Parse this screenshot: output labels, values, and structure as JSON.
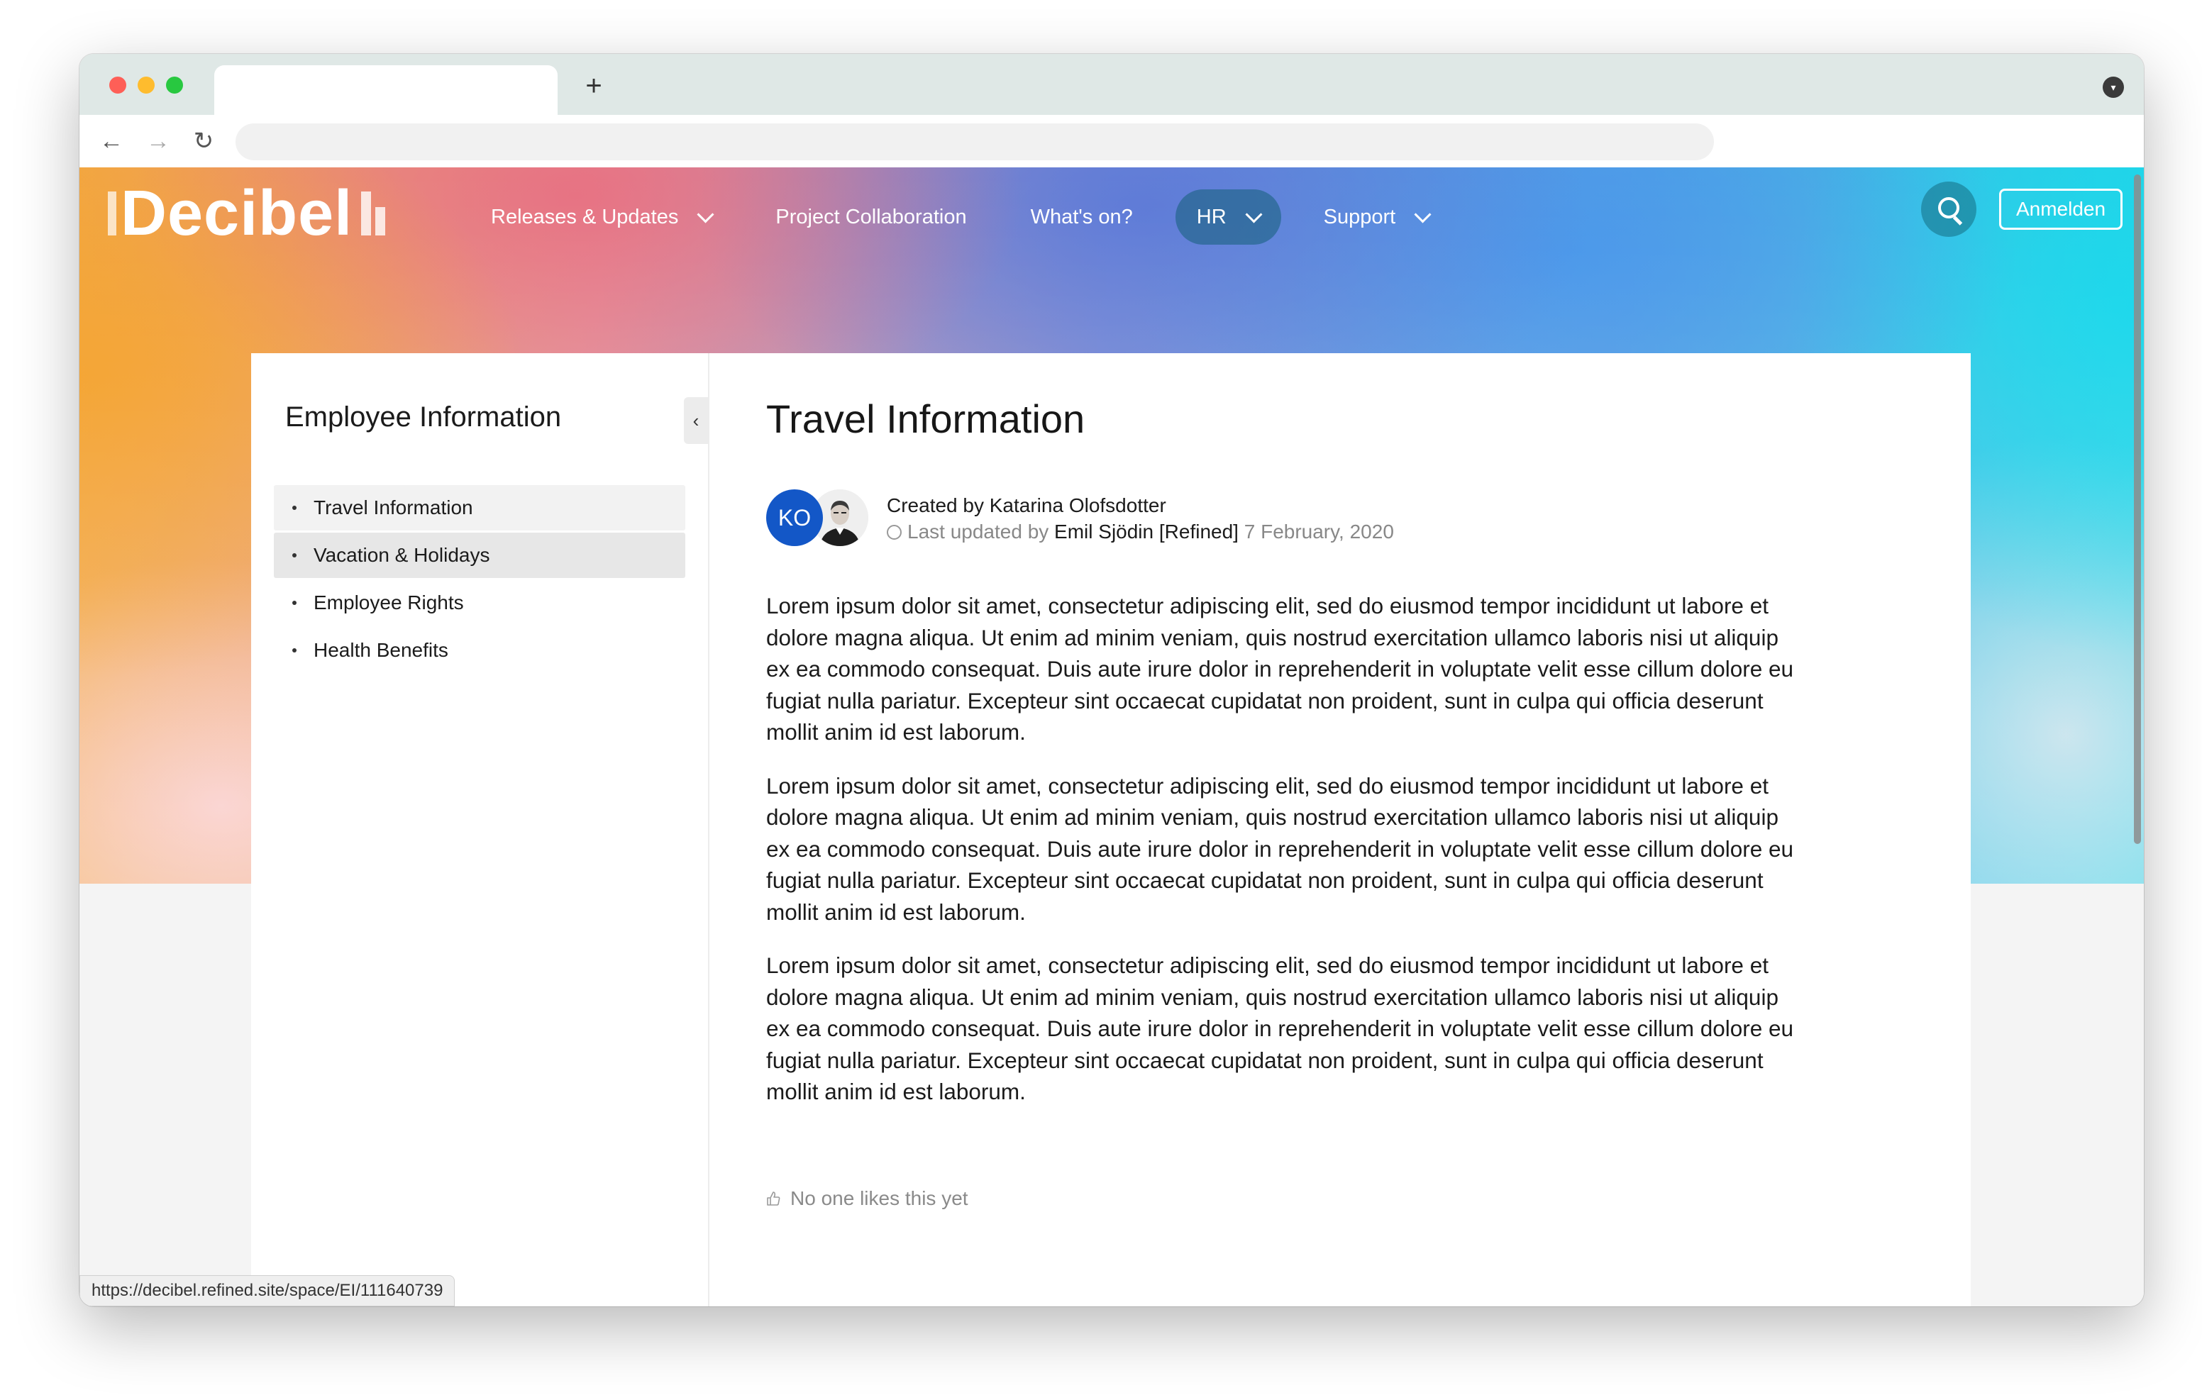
{
  "browser": {
    "new_tab_label": "+",
    "tab_menu_icon": "chevron-down-icon"
  },
  "site": {
    "logo_text": "Decibel",
    "nav": [
      {
        "label": "Releases & Updates",
        "has_dropdown": true
      },
      {
        "label": "Project Collaboration",
        "has_dropdown": false
      },
      {
        "label": "What's on?",
        "has_dropdown": false
      },
      {
        "label": "HR",
        "has_dropdown": true,
        "active": true
      },
      {
        "label": "Support",
        "has_dropdown": true
      }
    ],
    "login_label": "Anmelden"
  },
  "sidebar": {
    "title": "Employee Information",
    "collapse_icon": "‹",
    "items": [
      {
        "label": "Travel Information",
        "state": "current"
      },
      {
        "label": "Vacation & Holidays",
        "state": "hover"
      },
      {
        "label": "Employee Rights",
        "state": ""
      },
      {
        "label": "Health Benefits",
        "state": ""
      }
    ]
  },
  "page": {
    "title": "Travel Information",
    "avatar_initials": "KO",
    "created_prefix": "Created by ",
    "created_by": "Katarina Olofsdotter",
    "updated_prefix": "Last updated by ",
    "updated_by": "Emil Sjödin [Refined]",
    "updated_date": "7 February, 2020",
    "paragraphs": [
      "Lorem ipsum dolor sit amet, consectetur adipiscing elit, sed do eiusmod tempor incididunt ut labore et dolore magna aliqua. Ut enim ad minim veniam, quis nostrud exercitation ullamco laboris nisi ut aliquip ex ea commodo consequat. Duis aute irure dolor in reprehenderit in voluptate velit esse cillum dolore eu fugiat nulla pariatur. Excepteur sint occaecat cupidatat non proident, sunt in culpa qui officia deserunt mollit anim id est laborum.",
      "Lorem ipsum dolor sit amet, consectetur adipiscing elit, sed do eiusmod tempor incididunt ut labore et dolore magna aliqua. Ut enim ad minim veniam, quis nostrud exercitation ullamco laboris nisi ut aliquip ex ea commodo consequat. Duis aute irure dolor in reprehenderit in voluptate velit esse cillum dolore eu fugiat nulla pariatur. Excepteur sint occaecat cupidatat non proident, sunt in culpa qui officia deserunt mollit anim id est laborum.",
      "Lorem ipsum dolor sit amet, consectetur adipiscing elit, sed do eiusmod tempor incididunt ut labore et dolore magna aliqua. Ut enim ad minim veniam, quis nostrud exercitation ullamco laboris nisi ut aliquip ex ea commodo consequat. Duis aute irure dolor in reprehenderit in voluptate velit esse cillum dolore eu fugiat nulla pariatur. Excepteur sint occaecat cupidatat non proident, sunt in culpa qui officia deserunt mollit anim id est laborum."
    ],
    "likes_text": "No one likes this yet"
  },
  "status_bar": {
    "url": "https://decibel.refined.site/space/EI/111640739"
  },
  "colors": {
    "avatar_bg": "#1357c7",
    "active_nav_bg": "#145f78"
  }
}
